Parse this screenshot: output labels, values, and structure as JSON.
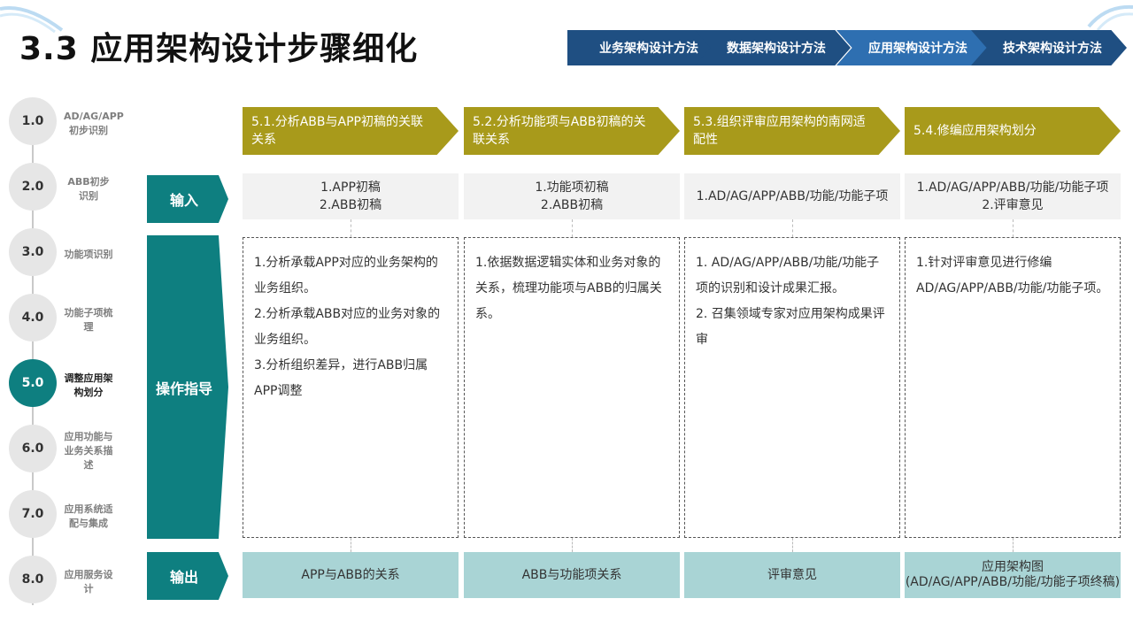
{
  "title": "3.3 应用架构设计步骤细化",
  "breadcrumbs": [
    {
      "label": "业务架构设计方法",
      "color": "#1f4f82"
    },
    {
      "label": "数据架构设计方法",
      "color": "#1f4f82"
    },
    {
      "label": "应用架构设计方法",
      "color": "#2e6fb1"
    },
    {
      "label": "技术架构设计方法",
      "color": "#1f4f82"
    }
  ],
  "steps": [
    {
      "num": "1.0",
      "label": "AD/AG/APP初步识别",
      "active": false
    },
    {
      "num": "2.0",
      "label": "ABB初步识别",
      "active": false
    },
    {
      "num": "3.0",
      "label": "功能项识别",
      "active": false
    },
    {
      "num": "4.0",
      "label": "功能子项梳理",
      "active": false
    },
    {
      "num": "5.0",
      "label": "调整应用架构划分",
      "active": true
    },
    {
      "num": "6.0",
      "label": "应用功能与业务关系描述",
      "active": false
    },
    {
      "num": "7.0",
      "label": "应用系统适配与集成",
      "active": false
    },
    {
      "num": "8.0",
      "label": "应用服务设计",
      "active": false
    }
  ],
  "row_headers": {
    "input": "输入",
    "ops": "操作指导",
    "output": "输出"
  },
  "phases": [
    {
      "title": "5.1.分析ABB与APP初稿的关联关系"
    },
    {
      "title": "5.2.分析功能项与ABB初稿的关联关系"
    },
    {
      "title": "5.3.组织评审应用架构的南网适配性"
    },
    {
      "title": "5.4.修编应用架构划分"
    }
  ],
  "inputs": [
    {
      "lines": [
        "1.APP初稿",
        "2.ABB初稿"
      ]
    },
    {
      "lines": [
        "1.功能项初稿",
        "2.ABB初稿"
      ]
    },
    {
      "lines": [
        "1.AD/AG/APP/ABB/功能/功能子项"
      ]
    },
    {
      "lines": [
        "1.AD/AG/APP/ABB/功能/功能子项",
        "2.评审意见"
      ]
    }
  ],
  "operations": [
    {
      "lines": [
        "1.分析承载APP对应的业务架构的业务组织。",
        "2.分析承载ABB对应的业务对象的业务组织。",
        "3.分析组织差异，进行ABB归属APP调整"
      ]
    },
    {
      "lines": [
        "1.依据数据逻辑实体和业务对象的关系，梳理功能项与ABB的归属关系。"
      ]
    },
    {
      "lines": [
        "1. AD/AG/APP/ABB/功能/功能子项的识别和设计成果汇报。",
        "2. 召集领域专家对应用架构成果评审"
      ]
    },
    {
      "lines": [
        "1.针对评审意见进行修编AD/AG/APP/ABB/功能/功能子项。"
      ]
    }
  ],
  "outputs": [
    {
      "lines": [
        "APP与ABB的关系"
      ]
    },
    {
      "lines": [
        "ABB与功能项关系"
      ]
    },
    {
      "lines": [
        "评审意见"
      ]
    },
    {
      "lines": [
        "应用架构图",
        "(AD/AG/APP/ABB/功能/功能子项终稿)"
      ]
    }
  ],
  "colors": {
    "teal": "#0e7f80",
    "olive": "#a89a1b",
    "navy": "#1f4f82",
    "light_teal": "#a9d4d5",
    "input_gray": "#f2f2f2"
  }
}
